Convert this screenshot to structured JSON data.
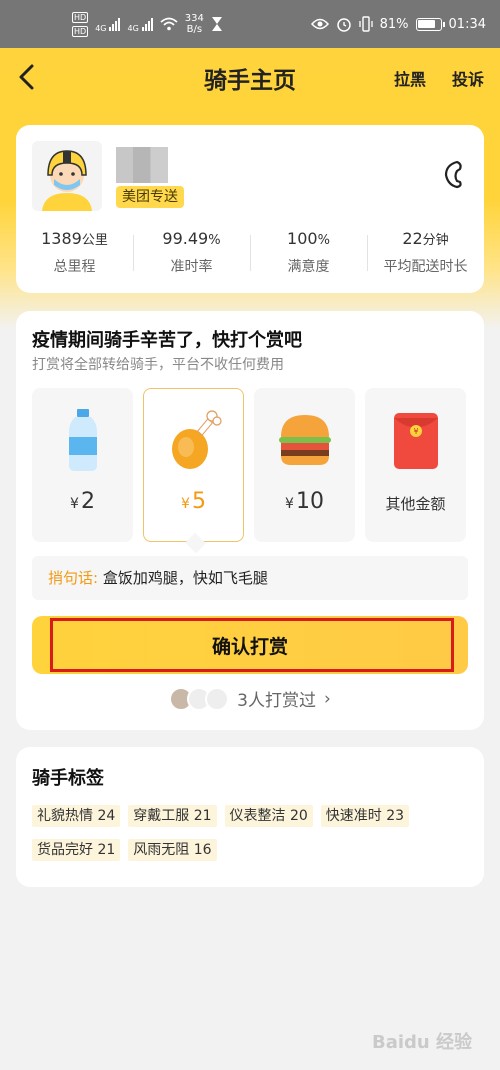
{
  "status_bar": {
    "hd1": "HD",
    "hd2": "HD",
    "net1": "4G",
    "net2": "4G",
    "speed_value": "334",
    "speed_unit": "B/s",
    "battery": "81%",
    "battery_level": 0.81,
    "time": "01:34"
  },
  "nav": {
    "title": "骑手主页",
    "block": "拉黑",
    "report": "投诉"
  },
  "rider": {
    "badge": "美团专送",
    "stats": [
      {
        "value": "1389",
        "unit": "公里",
        "label": "总里程"
      },
      {
        "value": "99.49",
        "unit": "%",
        "label": "准时率"
      },
      {
        "value": "100",
        "unit": "%",
        "label": "满意度"
      },
      {
        "value": "22",
        "unit": "分钟",
        "label": "平均配送时长"
      }
    ]
  },
  "tip": {
    "title": "疫情期间骑手辛苦了，快打个赏吧",
    "subtitle": "打赏将全部转给骑手，平台不收任何费用",
    "options": [
      {
        "icon": "water-bottle-icon",
        "currency": "¥",
        "amount": "2"
      },
      {
        "icon": "chicken-leg-icon",
        "currency": "¥",
        "amount": "5"
      },
      {
        "icon": "burger-icon",
        "currency": "¥",
        "amount": "10"
      },
      {
        "icon": "red-envelope-icon",
        "label": "其他金额"
      }
    ],
    "selected_index": 1,
    "message_label": "捎句话:",
    "message_text": "盒饭加鸡腿，快如飞毛腿",
    "confirm": "确认打赏",
    "tipped_count": "3人打赏过",
    "tipped_chevron": "›"
  },
  "tags": {
    "title": "骑手标签",
    "items": [
      "礼貌热情 24",
      "穿戴工服 21",
      "仪表整洁 20",
      "快速准时 23",
      "货品完好 21",
      "风雨无阻 16"
    ]
  },
  "watermark": "Baidu 经验",
  "colors": {
    "accent": "#ffd33c",
    "highlight": "#f29a11",
    "annotation_box": "#d81c1c"
  }
}
